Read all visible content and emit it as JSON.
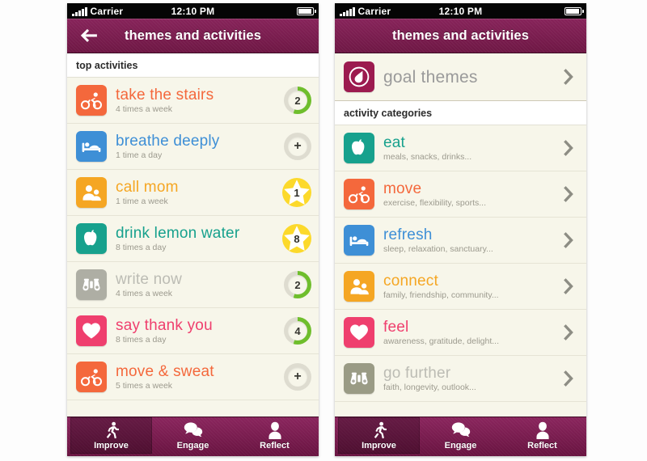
{
  "colors": {
    "brand_maroon": "#7a1c4c",
    "page_bg": "#fdfdfd",
    "list_bg": "#f7f6ea",
    "progress_green": "#6fbe2c",
    "star_gold": "#fcd92b",
    "orange": "#f4683c",
    "blue": "#3e8fd6",
    "amber": "#f5a623",
    "teal": "#17a18d",
    "grey": "#aaaaa0",
    "pink": "#ef3f6e",
    "olive": "#9a9b85",
    "goal_maroon": "#9c1b4f"
  },
  "statusbar": {
    "carrier": "Carrier",
    "time": "12:10 PM",
    "signal_icon": "signal-bars-icon",
    "battery_icon": "battery-icon"
  },
  "screens": [
    {
      "id": "top-activities",
      "navbar": {
        "title": "themes and activities",
        "back_icon": "back-arrow-icon",
        "has_back": true
      },
      "section_title": "top activities",
      "rows": [
        {
          "title": "take the stairs",
          "subtitle": "4 times a week",
          "icon": "cyclist-icon",
          "icon_color": "#f4683c",
          "title_color": "#f4683c",
          "badge": {
            "kind": "ring",
            "value": "2",
            "percent": 55
          }
        },
        {
          "title": "breathe deeply",
          "subtitle": "1 time a day",
          "icon": "bed-icon",
          "icon_color": "#3e8fd6",
          "title_color": "#3e8fd6",
          "badge": {
            "kind": "plus",
            "value": "+",
            "percent": 0
          }
        },
        {
          "title": "call mom",
          "subtitle": "1 time a week",
          "icon": "people-icon",
          "icon_color": "#f5a623",
          "title_color": "#f5a623",
          "badge": {
            "kind": "star",
            "value": "1",
            "percent": 100
          }
        },
        {
          "title": "drink lemon water",
          "subtitle": "8 times a day",
          "icon": "apple-icon",
          "icon_color": "#17a18d",
          "title_color": "#17a18d",
          "badge": {
            "kind": "star",
            "value": "8",
            "percent": 100
          }
        },
        {
          "title": "write now",
          "subtitle": "4 times a week",
          "icon": "binoculars-icon",
          "icon_color": "#aeaea4",
          "title_color": "#bcbcb4",
          "badge": {
            "kind": "ring",
            "value": "2",
            "percent": 55
          }
        },
        {
          "title": "say thank you",
          "subtitle": "8 times a day",
          "icon": "heart-icon",
          "icon_color": "#ef3f6e",
          "title_color": "#ef3f6e",
          "badge": {
            "kind": "ring",
            "value": "4",
            "percent": 55
          }
        },
        {
          "title": "move & sweat",
          "subtitle": "5 times a week",
          "icon": "cyclist-icon",
          "icon_color": "#f4683c",
          "title_color": "#f4683c",
          "badge": {
            "kind": "plus",
            "value": "+",
            "percent": 0
          }
        }
      ]
    },
    {
      "id": "activity-categories",
      "navbar": {
        "title": "themes and activities",
        "back_icon": "back-arrow-icon",
        "has_back": false
      },
      "goal_row": {
        "title": "goal themes",
        "icon": "droplet-icon",
        "icon_color": "#9c1b4f",
        "title_color": "#9a9a9a",
        "chevron_icon": "chevron-right-icon"
      },
      "section_title": "activity categories",
      "rows": [
        {
          "title": "eat",
          "subtitle": "meals, snacks, drinks...",
          "icon": "apple-icon",
          "icon_color": "#17a18d",
          "title_color": "#17a18d",
          "badge": {
            "kind": "chevron",
            "value": "",
            "percent": 0
          }
        },
        {
          "title": "move",
          "subtitle": "exercise, flexibility, sports...",
          "icon": "cyclist-icon",
          "icon_color": "#f4683c",
          "title_color": "#f4683c",
          "badge": {
            "kind": "chevron",
            "value": "",
            "percent": 0
          }
        },
        {
          "title": "refresh",
          "subtitle": "sleep, relaxation, sanctuary...",
          "icon": "bed-icon",
          "icon_color": "#3e8fd6",
          "title_color": "#3e8fd6",
          "badge": {
            "kind": "chevron",
            "value": "",
            "percent": 0
          }
        },
        {
          "title": "connect",
          "subtitle": "family, friendship, community...",
          "icon": "people-icon",
          "icon_color": "#f5a623",
          "title_color": "#f5a623",
          "badge": {
            "kind": "chevron",
            "value": "",
            "percent": 0
          }
        },
        {
          "title": "feel",
          "subtitle": "awareness, gratitude, delight...",
          "icon": "heart-icon",
          "icon_color": "#ef3f6e",
          "title_color": "#ef3f6e",
          "badge": {
            "kind": "chevron",
            "value": "",
            "percent": 0
          }
        },
        {
          "title": "go further",
          "subtitle": "faith, longevity, outlook...",
          "icon": "binoculars-icon",
          "icon_color": "#9a9b85",
          "title_color": "#bcbcb4",
          "badge": {
            "kind": "chevron",
            "value": "",
            "percent": 0
          }
        }
      ]
    }
  ],
  "tabbar": {
    "tabs": [
      {
        "label": "Improve",
        "icon": "runner-icon",
        "active": true
      },
      {
        "label": "Engage",
        "icon": "speech-bubbles-icon",
        "active": false
      },
      {
        "label": "Reflect",
        "icon": "person-icon",
        "active": false
      }
    ]
  }
}
